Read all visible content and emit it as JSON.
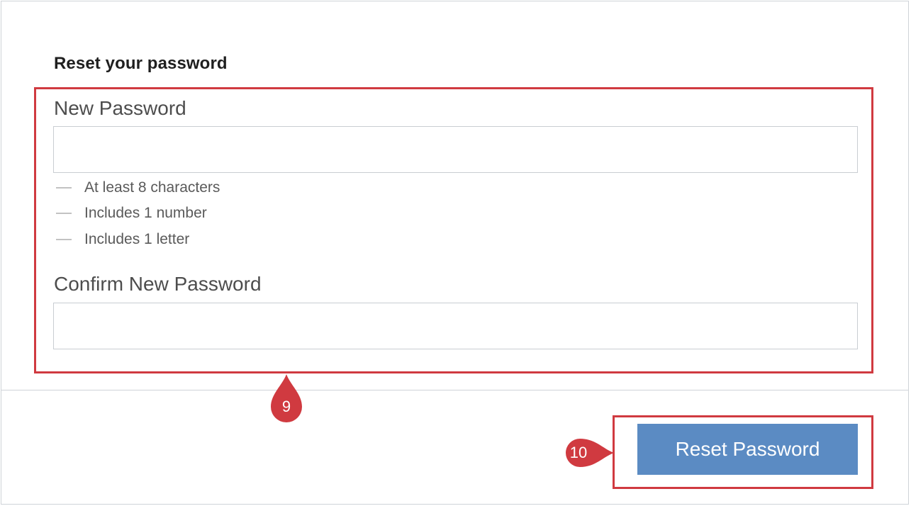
{
  "form": {
    "heading": "Reset your password",
    "new_password_label": "New Password",
    "new_password_value": "",
    "requirements": [
      "At least 8 characters",
      "Includes 1 number",
      "Includes 1 letter"
    ],
    "confirm_password_label": "Confirm New Password",
    "confirm_password_value": ""
  },
  "footer": {
    "reset_button_label": "Reset Password"
  },
  "annotations": {
    "callout_form": "9",
    "callout_button": "10"
  },
  "colors": {
    "accent_button": "#5b8bc3",
    "annotation_red": "#d03a40",
    "border": "#cfd3d8"
  },
  "icons": {
    "requirement_status": "dash-icon"
  }
}
